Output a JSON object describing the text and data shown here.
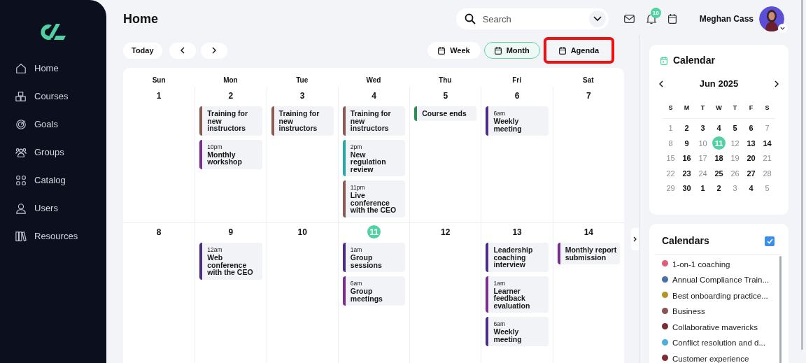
{
  "sidebar": {
    "items": [
      {
        "label": "Home"
      },
      {
        "label": "Courses"
      },
      {
        "label": "Goals"
      },
      {
        "label": "Groups"
      },
      {
        "label": "Catalog"
      },
      {
        "label": "Users"
      },
      {
        "label": "Resources"
      }
    ]
  },
  "header": {
    "title": "Home",
    "search": {
      "placeholder": "Search"
    },
    "notifications": "18",
    "user": "Meghan Cass"
  },
  "toolbar": {
    "today": "Today",
    "views": [
      {
        "label": "Week",
        "selected": false,
        "highlighted": false
      },
      {
        "label": "Month",
        "selected": true,
        "highlighted": false
      },
      {
        "label": "Agenda",
        "selected": false,
        "highlighted": true
      }
    ]
  },
  "month": {
    "weekdays": [
      "Sun",
      "Mon",
      "Tue",
      "Wed",
      "Thu",
      "Fri",
      "Sat"
    ],
    "weeks": [
      [
        {
          "day": "1",
          "today": false
        },
        {
          "day": "2",
          "today": false,
          "events": [
            {
              "title": "Training for new instructors",
              "color": "#8b5a55"
            },
            {
              "time": "10pm",
              "title": "Monthly workshop",
              "color": "#7b2d8e"
            }
          ]
        },
        {
          "day": "3",
          "today": false,
          "events": [
            {
              "title": "Training for new instructors",
              "color": "#8b5a55"
            }
          ]
        },
        {
          "day": "4",
          "today": false,
          "events": [
            {
              "title": "Training for new instructors",
              "color": "#8b5a55"
            },
            {
              "time": "2pm",
              "title": "New regulation review",
              "color": "#2aa5a5"
            },
            {
              "time": "11pm",
              "title": "Live conference with the CEO",
              "color": "#8b5a55"
            }
          ]
        },
        {
          "day": "5",
          "today": false,
          "events": [
            {
              "title": "Course ends",
              "color": "#2e8b57"
            }
          ]
        },
        {
          "day": "6",
          "today": false,
          "events": [
            {
              "time": "6am",
              "title": "Weekly meeting",
              "color": "#4b2e83"
            }
          ]
        },
        {
          "day": "7",
          "today": false
        }
      ],
      [
        {
          "day": "8",
          "today": false
        },
        {
          "day": "9",
          "today": false,
          "events": [
            {
              "time": "12am",
              "title": "Web conference with the CEO",
              "color": "#4b2e83"
            }
          ]
        },
        {
          "day": "10",
          "today": false
        },
        {
          "day": "11",
          "today": true,
          "events": [
            {
              "time": "1am",
              "title": "Group sessions",
              "color": "#4b2e83"
            },
            {
              "time": "6am",
              "title": "Group meetings",
              "color": "#7b2d8e"
            }
          ]
        },
        {
          "day": "12",
          "today": false
        },
        {
          "day": "13",
          "today": false,
          "events": [
            {
              "title": "Leadership coaching interview",
              "color": "#4b2e83"
            },
            {
              "time": "1am",
              "title": "Learner feedback evaluation",
              "color": "#7b2d8e"
            },
            {
              "time": "6am",
              "title": "Weekly meeting",
              "color": "#4b2e83"
            }
          ]
        },
        {
          "day": "14",
          "today": false,
          "events": [
            {
              "title": "Monthly report submission",
              "color": "#7b2d8e"
            }
          ]
        }
      ]
    ]
  },
  "mini_calendar": {
    "title": "Calendar",
    "month": "Jun 2025",
    "weekdays": [
      "S",
      "M",
      "T",
      "W",
      "T",
      "F",
      "S"
    ],
    "days": [
      {
        "day": "1",
        "bold": false,
        "selected": false
      },
      {
        "day": "2",
        "bold": true,
        "selected": false
      },
      {
        "day": "3",
        "bold": true,
        "selected": false
      },
      {
        "day": "4",
        "bold": true,
        "selected": false
      },
      {
        "day": "5",
        "bold": true,
        "selected": false
      },
      {
        "day": "6",
        "bold": true,
        "selected": false
      },
      {
        "day": "7",
        "bold": false,
        "selected": false
      },
      {
        "day": "8",
        "bold": false,
        "selected": false
      },
      {
        "day": "9",
        "bold": true,
        "selected": false
      },
      {
        "day": "10",
        "bold": false,
        "selected": false
      },
      {
        "day": "11",
        "bold": true,
        "selected": true
      },
      {
        "day": "12",
        "bold": false,
        "selected": false
      },
      {
        "day": "13",
        "bold": true,
        "selected": false
      },
      {
        "day": "14",
        "bold": true,
        "selected": false
      },
      {
        "day": "15",
        "bold": false,
        "selected": false
      },
      {
        "day": "16",
        "bold": true,
        "selected": false
      },
      {
        "day": "17",
        "bold": false,
        "selected": false
      },
      {
        "day": "18",
        "bold": true,
        "selected": false
      },
      {
        "day": "19",
        "bold": false,
        "selected": false
      },
      {
        "day": "20",
        "bold": true,
        "selected": false
      },
      {
        "day": "21",
        "bold": false,
        "selected": false
      },
      {
        "day": "22",
        "bold": false,
        "selected": false
      },
      {
        "day": "23",
        "bold": true,
        "selected": false
      },
      {
        "day": "24",
        "bold": false,
        "selected": false
      },
      {
        "day": "25",
        "bold": true,
        "selected": false
      },
      {
        "day": "26",
        "bold": false,
        "selected": false
      },
      {
        "day": "27",
        "bold": true,
        "selected": false
      },
      {
        "day": "28",
        "bold": false,
        "selected": false
      },
      {
        "day": "29",
        "bold": false,
        "selected": false
      },
      {
        "day": "30",
        "bold": true,
        "selected": false
      },
      {
        "day": "1",
        "bold": true,
        "selected": false
      },
      {
        "day": "2",
        "bold": true,
        "selected": false
      },
      {
        "day": "3",
        "bold": false,
        "selected": false
      },
      {
        "day": "4",
        "bold": true,
        "selected": false
      },
      {
        "day": "5",
        "bold": false,
        "selected": false
      }
    ]
  },
  "calendars": {
    "title": "Calendars",
    "checked": true,
    "items": [
      {
        "label": "1-on-1 coaching",
        "color": "#e05a7a"
      },
      {
        "label": "Annual Compliance Train...",
        "color": "#4a6fa5"
      },
      {
        "label": "Best onboarding practice...",
        "color": "#b0962a"
      },
      {
        "label": "Business",
        "color": "#875555"
      },
      {
        "label": "Collaborative mavericks",
        "color": "#7a2e33"
      },
      {
        "label": "Conflict resolution and d...",
        "color": "#4aaee0"
      },
      {
        "label": "Customer experience",
        "color": "#7a2e33"
      }
    ]
  }
}
